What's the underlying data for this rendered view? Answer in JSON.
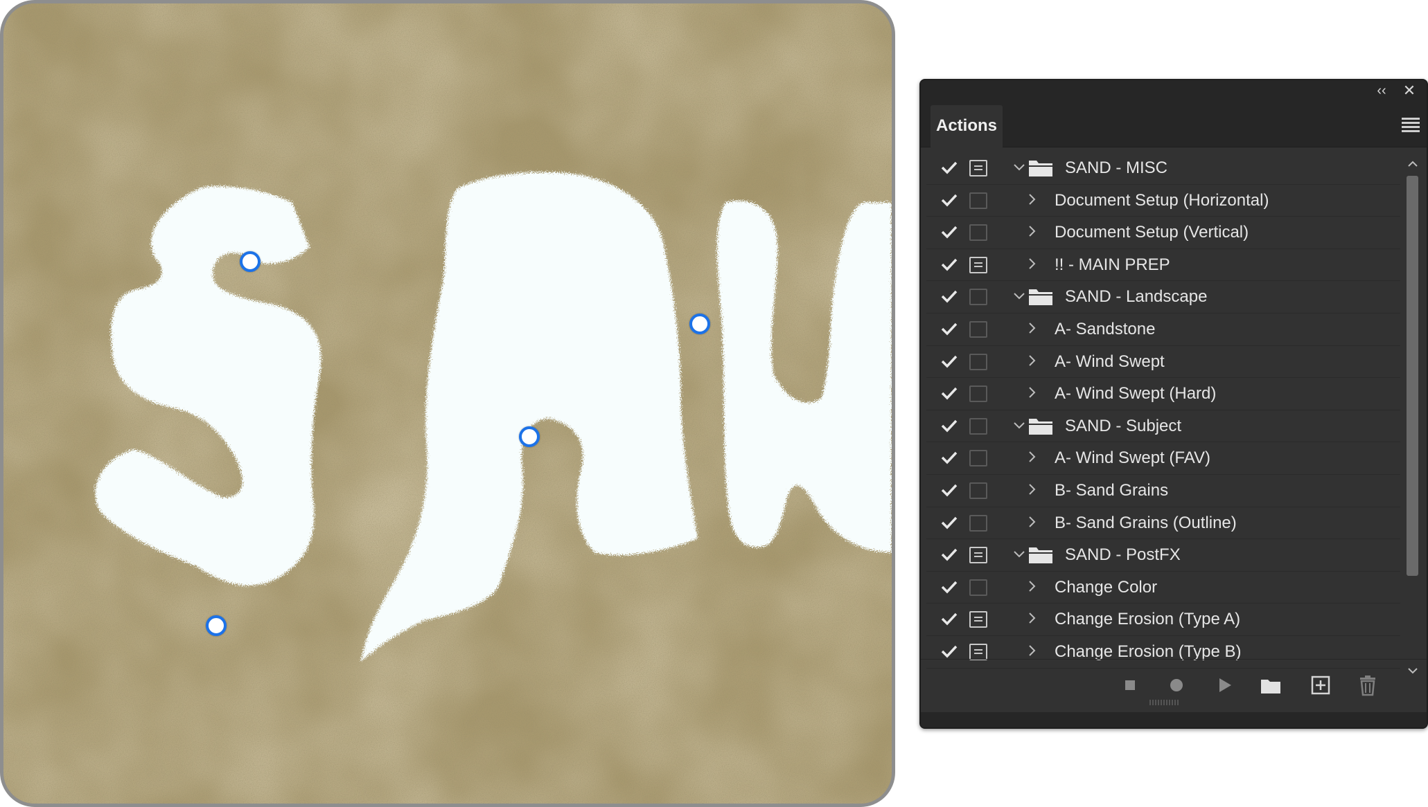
{
  "panel": {
    "title": "Actions",
    "collapse_glyph": "‹‹",
    "close_glyph": "✕",
    "menu_icon": "hamburger-menu-icon"
  },
  "rows": [
    {
      "kind": "set",
      "label": "SAND - MISC",
      "enabled": true,
      "dialog": true,
      "expanded": true
    },
    {
      "kind": "action",
      "label": "Document Setup (Horizontal)",
      "enabled": true,
      "dialog": false
    },
    {
      "kind": "action",
      "label": "Document Setup (Vertical)",
      "enabled": true,
      "dialog": false
    },
    {
      "kind": "action",
      "label": "!! - MAIN PREP",
      "enabled": true,
      "dialog": true
    },
    {
      "kind": "set",
      "label": "SAND - Landscape",
      "enabled": true,
      "dialog": false,
      "expanded": true
    },
    {
      "kind": "action",
      "label": "A- Sandstone",
      "enabled": true,
      "dialog": false
    },
    {
      "kind": "action",
      "label": "A- Wind Swept",
      "enabled": true,
      "dialog": false
    },
    {
      "kind": "action",
      "label": "A- Wind Swept (Hard)",
      "enabled": true,
      "dialog": false
    },
    {
      "kind": "set",
      "label": "SAND - Subject",
      "enabled": true,
      "dialog": false,
      "expanded": true
    },
    {
      "kind": "action",
      "label": "A- Wind Swept (FAV)",
      "enabled": true,
      "dialog": false
    },
    {
      "kind": "action",
      "label": "B- Sand Grains",
      "enabled": true,
      "dialog": false
    },
    {
      "kind": "action",
      "label": "B- Sand Grains (Outline)",
      "enabled": true,
      "dialog": false
    },
    {
      "kind": "set",
      "label": "SAND - PostFX",
      "enabled": true,
      "dialog": true,
      "expanded": true
    },
    {
      "kind": "action",
      "label": "Change Color",
      "enabled": true,
      "dialog": false
    },
    {
      "kind": "action",
      "label": "Change Erosion (Type A)",
      "enabled": true,
      "dialog": true
    },
    {
      "kind": "action",
      "label": "Change Erosion (Type B)",
      "enabled": true,
      "dialog": true
    }
  ],
  "footer_buttons": [
    {
      "name": "stop-button",
      "icon": "stop-icon"
    },
    {
      "name": "record-button",
      "icon": "record-icon"
    },
    {
      "name": "play-button",
      "icon": "play-icon"
    },
    {
      "name": "create-set-button",
      "icon": "folder-icon"
    },
    {
      "name": "new-action-button",
      "icon": "new-item-icon"
    },
    {
      "name": "delete-button",
      "icon": "trash-icon"
    }
  ],
  "colors": {
    "panel_bg": "#323232",
    "sand": "#a6976d",
    "letter_fill": "#f7fdfd",
    "handle_accent": "#1c72e8"
  }
}
